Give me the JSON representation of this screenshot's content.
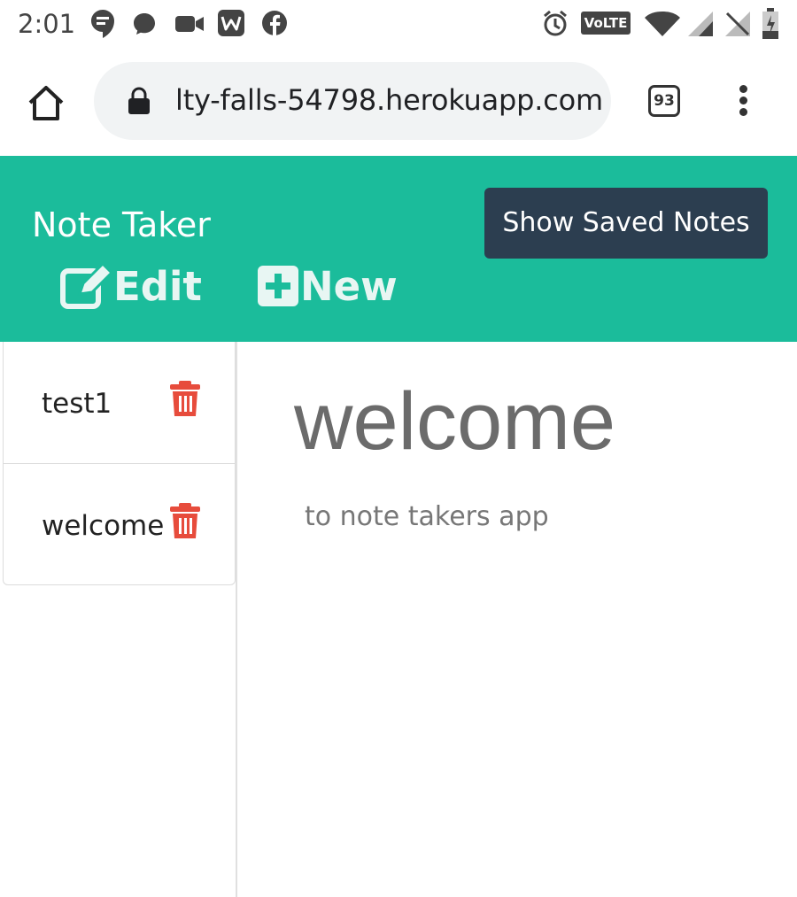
{
  "status_bar": {
    "time": "2:01",
    "left_icons": [
      "hangouts-icon",
      "messenger-icon",
      "video-icon",
      "w-app-icon",
      "facebook-icon"
    ],
    "right_icons": [
      "alarm-icon",
      "volte-icon",
      "wifi-icon",
      "signal-icon",
      "no-signal-icon",
      "battery-icon"
    ],
    "volte_label": "VoLTE"
  },
  "browser": {
    "url": "lty-falls-54798.herokuapp.com",
    "tab_count": "93"
  },
  "app": {
    "title": "Note Taker",
    "show_saved_label": "Show Saved Notes",
    "edit_label": "Edit",
    "new_label": "New",
    "colors": {
      "header": "#1bbc9b",
      "button": "#2c3e50",
      "trash": "#e74c3c"
    }
  },
  "notes": [
    {
      "title": "test1"
    },
    {
      "title": "welcome"
    }
  ],
  "active_note": {
    "title": "welcome",
    "text": "to note takers app"
  }
}
